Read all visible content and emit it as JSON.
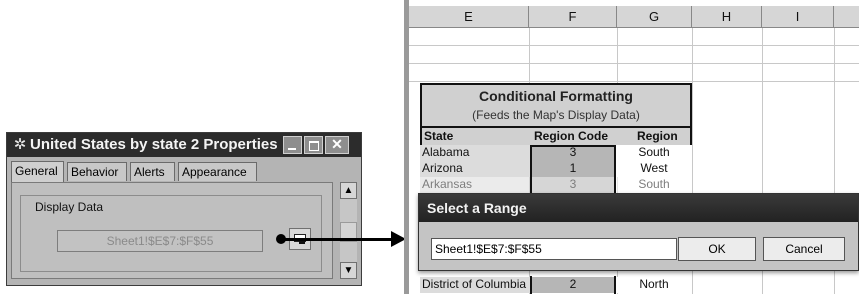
{
  "properties_window": {
    "title": "United States by state 2 Properties",
    "title_icon": "gear-icon",
    "tabs": [
      {
        "label": "General",
        "active": true
      },
      {
        "label": "Behavior",
        "active": false
      },
      {
        "label": "Alerts",
        "active": false
      },
      {
        "label": "Appearance",
        "active": false
      }
    ],
    "group_label": "Display Data",
    "range_value": "Sheet1!$E$7:$F$55"
  },
  "spreadsheet": {
    "columns": [
      "E",
      "F",
      "G",
      "H",
      "I"
    ],
    "block_title": "Conditional Formatting",
    "block_subtitle": "(Feeds the Map's Display Data)",
    "headers": {
      "state": "State",
      "code": "Region Code",
      "region": "Region"
    },
    "rows": [
      {
        "state": "Alabama",
        "code": "3",
        "region": "South"
      },
      {
        "state": "Arizona",
        "code": "1",
        "region": "West"
      },
      {
        "state": "Arkansas",
        "code": "3",
        "region": "South"
      }
    ],
    "last_row": {
      "state": "District of Columbia",
      "code": "2",
      "region": "North"
    }
  },
  "select_range_dialog": {
    "title": "Select a Range",
    "value": "Sheet1!$E$7:$F$55",
    "ok_label": "OK",
    "cancel_label": "Cancel"
  }
}
